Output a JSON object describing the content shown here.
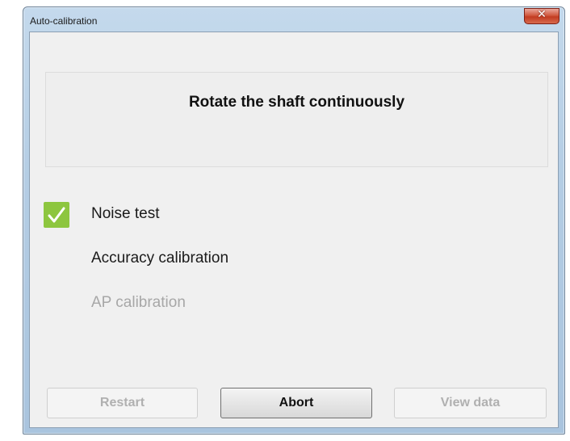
{
  "window": {
    "title": "Auto-calibration",
    "close_glyph": "✕"
  },
  "instruction": {
    "text": "Rotate the shaft continuously"
  },
  "steps": [
    {
      "label": "Noise test",
      "status": "done"
    },
    {
      "label": "Accuracy calibration",
      "status": "active"
    },
    {
      "label": "AP calibration",
      "status": "pending"
    }
  ],
  "buttons": {
    "restart": {
      "label": "Restart",
      "enabled": false
    },
    "abort": {
      "label": "Abort",
      "enabled": true
    },
    "view_data": {
      "label": "View data",
      "enabled": false
    }
  },
  "colors": {
    "check_green": "#8dc63f",
    "pending_text": "#a7a7a7"
  }
}
